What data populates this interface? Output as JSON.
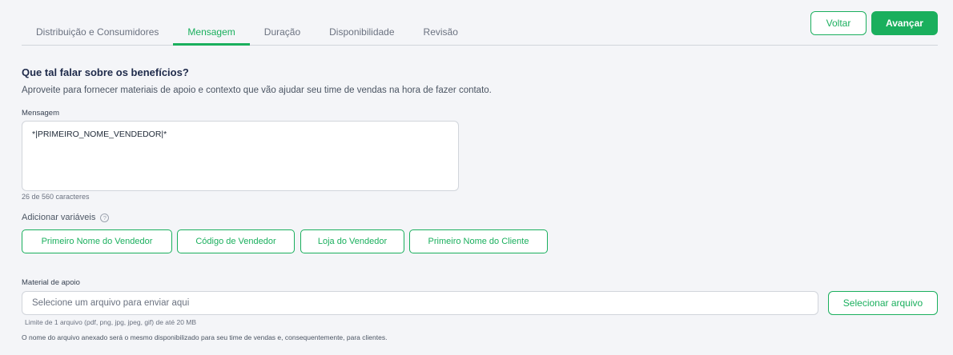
{
  "tabs": [
    {
      "label": "Distribuição e Consumidores",
      "active": false
    },
    {
      "label": "Mensagem",
      "active": true
    },
    {
      "label": "Duração",
      "active": false
    },
    {
      "label": "Disponibilidade",
      "active": false
    },
    {
      "label": "Revisão",
      "active": false
    }
  ],
  "actions": {
    "back_label": "Voltar",
    "next_label": "Avançar"
  },
  "section": {
    "title": "Que tal falar sobre os benefícios?",
    "description": "Aproveite para fornecer materiais de apoio e contexto que vão ajudar seu time de vendas na hora de fazer contato."
  },
  "message": {
    "label": "Mensagem",
    "value": "*|PRIMEIRO_NOME_VENDEDOR|*",
    "counter": "26 de 560 caracteres"
  },
  "variables": {
    "label": "Adicionar variáveis",
    "help_icon_glyph": "?",
    "chips": [
      "Primeiro Nome do Vendedor",
      "Código de Vendedor",
      "Loja do Vendedor",
      "Primeiro Nome do Cliente"
    ]
  },
  "support": {
    "label": "Material de apoio",
    "placeholder": "Selecione um arquivo para enviar aqui",
    "select_label": "Selecionar arquivo",
    "limit_hint": "Limite de 1 arquivo (pdf, png, jpg, jpeg, gif) de até 20 MB",
    "name_hint": "O nome do arquivo anexado será o mesmo disponibilizado para seu time de vendas e, consequentemente, para clientes."
  },
  "colors": {
    "accent": "#1aaf5d",
    "background": "#f4f5f8",
    "title": "#1e2a4a"
  }
}
